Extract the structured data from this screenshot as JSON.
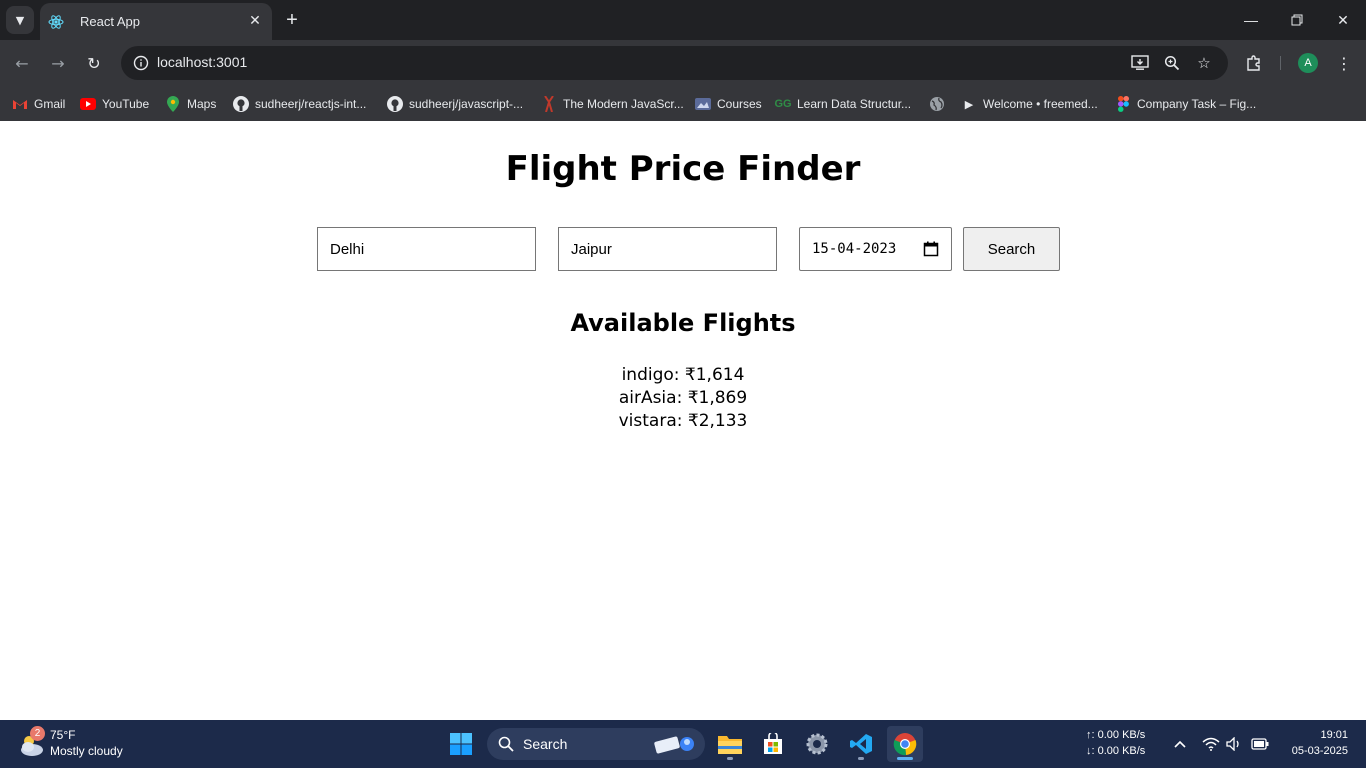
{
  "browser": {
    "tab_title": "React App",
    "url": "localhost:3001",
    "profile_initial": "A",
    "bookmarks": [
      {
        "label": "Gmail",
        "icon": "gmail-icon"
      },
      {
        "label": "YouTube",
        "icon": "youtube-icon"
      },
      {
        "label": "Maps",
        "icon": "maps-icon"
      },
      {
        "label": "sudheerj/reactjs-int...",
        "icon": "github-icon"
      },
      {
        "label": "sudheerj/javascript-...",
        "icon": "github-icon"
      },
      {
        "label": "The Modern JavaScr...",
        "icon": "javascript-info-icon"
      },
      {
        "label": "Courses",
        "icon": "courses-icon"
      },
      {
        "label": "Learn Data Structur...",
        "icon": "geeksforgeeks-icon"
      },
      {
        "label": "",
        "icon": "globe-icon"
      },
      {
        "label": "Welcome • freemed...",
        "icon": "play-icon"
      },
      {
        "label": "Company Task – Fig...",
        "icon": "figma-icon"
      }
    ]
  },
  "app": {
    "title": "Flight Price Finder",
    "source_value": "Delhi",
    "destination_value": "Jaipur",
    "date_value": "15-04-2023",
    "search_label": "Search",
    "results_title": "Available Flights",
    "flights": [
      {
        "text": "indigo: ₹1,614"
      },
      {
        "text": "airAsia: ₹1,869"
      },
      {
        "text": "vistara: ₹2,133"
      }
    ]
  },
  "taskbar": {
    "weather_temp": "75°F",
    "weather_desc": "Mostly cloudy",
    "weather_badge": "2",
    "search_label": "Search",
    "net_up": "↑: 0.00 KB/s",
    "net_down": "↓: 0.00 KB/s",
    "time": "19:01",
    "date": "05-03-2025"
  },
  "colors": {
    "chrome_dark": "#202124",
    "chrome_toolbar": "#35363a",
    "taskbar": "#1c2a4a",
    "button_bg": "#efefef"
  }
}
